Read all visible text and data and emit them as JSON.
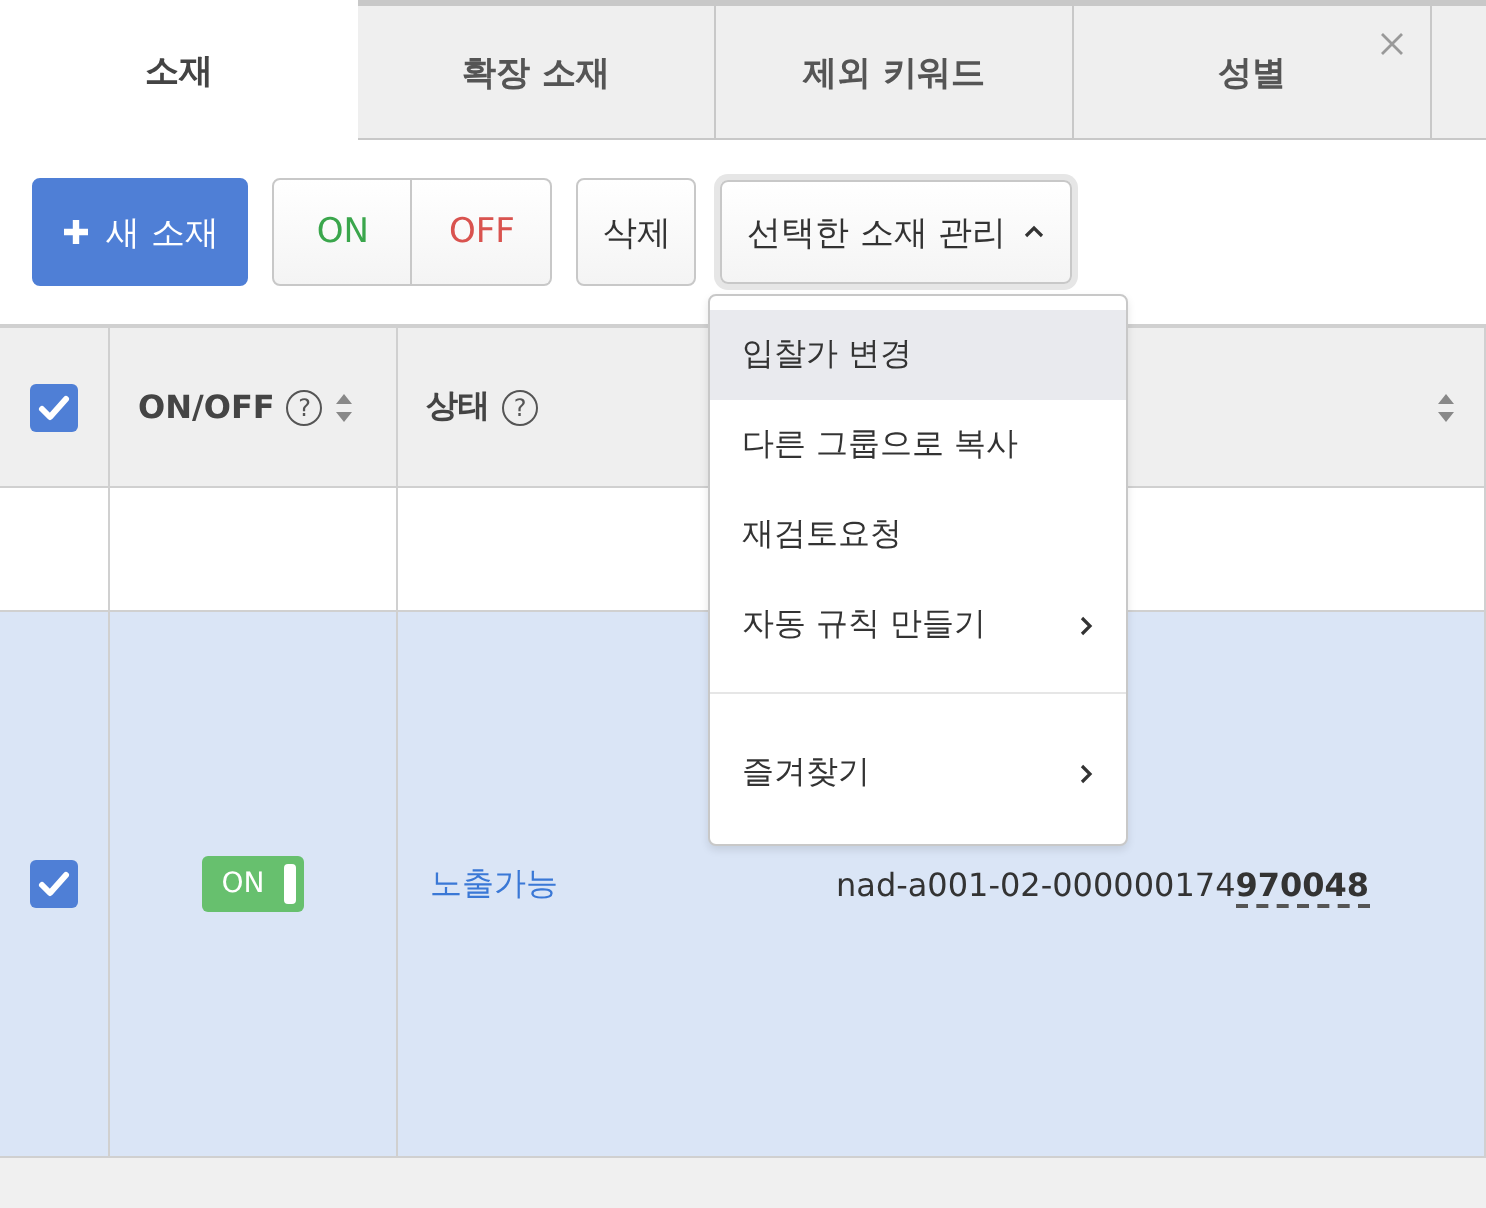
{
  "tabs": [
    {
      "label": "소재",
      "selected": true,
      "closable": false
    },
    {
      "label": "확장 소재",
      "selected": false,
      "closable": false
    },
    {
      "label": "제외 키워드",
      "selected": false,
      "closable": false
    },
    {
      "label": "성별",
      "selected": false,
      "closable": true
    }
  ],
  "toolbar": {
    "new_button": "새 소재",
    "on_button": "ON",
    "off_button": "OFF",
    "delete_button": "삭제",
    "manage_dropdown": {
      "label": "선택한 소재 관리",
      "expanded": true
    }
  },
  "menu": [
    {
      "label": "입찰가 변경",
      "highlighted": true,
      "submenu": false,
      "divider_before": false
    },
    {
      "label": "다른 그룹으로 복사",
      "highlighted": false,
      "submenu": false,
      "divider_before": false
    },
    {
      "label": "재검토요청",
      "highlighted": false,
      "submenu": false,
      "divider_before": false
    },
    {
      "label": "자동 규칙 만들기",
      "highlighted": false,
      "submenu": true,
      "divider_before": false
    },
    {
      "label": "즐겨찾기",
      "highlighted": false,
      "submenu": true,
      "divider_before": true
    }
  ],
  "table": {
    "header_checked": true,
    "columns": [
      {
        "label": "ON/OFF",
        "help": "?",
        "sortable": true
      },
      {
        "label": "상태",
        "help": "?",
        "sortable": false
      },
      {
        "sortable": true
      }
    ],
    "rows": [
      {
        "kind": "empty",
        "selected": false
      },
      {
        "kind": "item",
        "selected": true,
        "checked": true,
        "on": true,
        "on_label": "ON",
        "status": "노출가능",
        "id": "nad-a001-02-000000174**970048**"
      }
    ]
  }
}
